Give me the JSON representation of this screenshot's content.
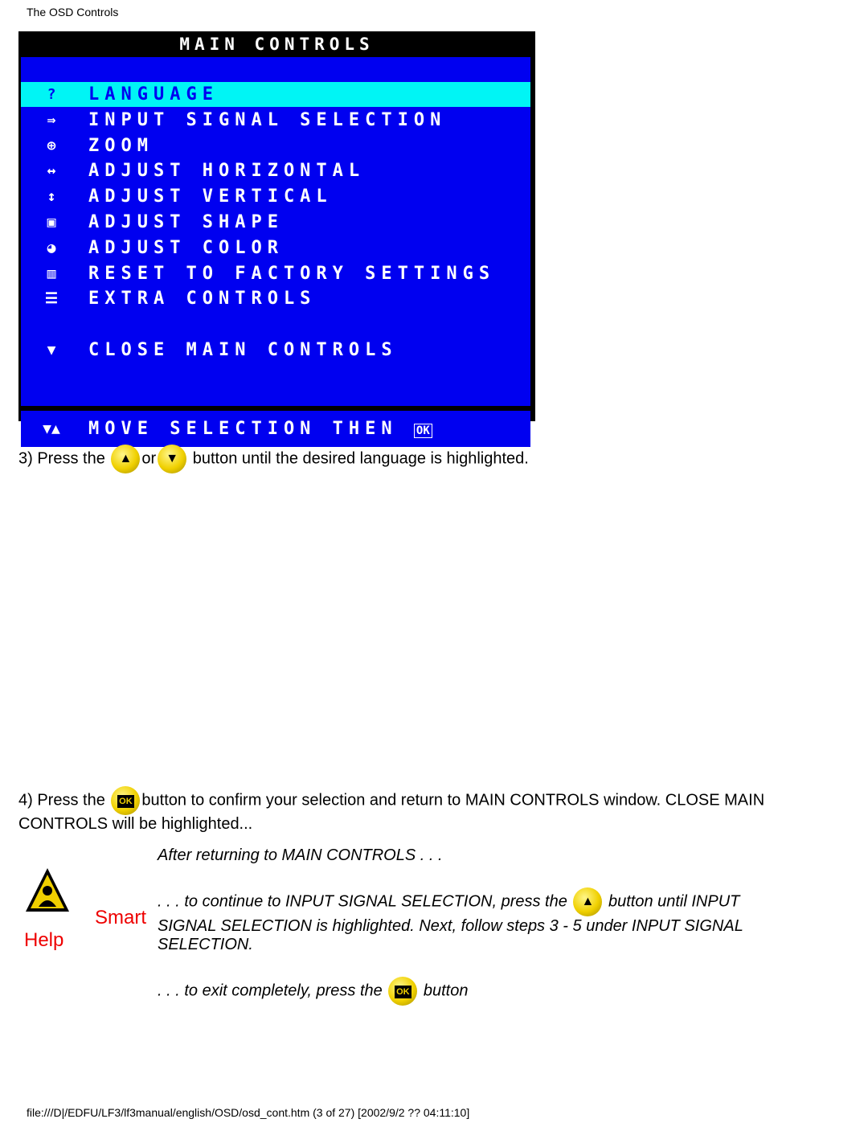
{
  "header": {
    "title": "The OSD Controls"
  },
  "osd": {
    "title": "MAIN CONTROLS",
    "items": [
      {
        "icon": "language-icon",
        "glyph": "?",
        "label": "LANGUAGE",
        "selected": true
      },
      {
        "icon": "input-signal-icon",
        "glyph": "⇛",
        "label": "INPUT SIGNAL SELECTION"
      },
      {
        "icon": "zoom-icon",
        "glyph": "⊕",
        "label": "ZOOM"
      },
      {
        "icon": "horizontal-icon",
        "glyph": "↔",
        "label": "ADJUST HORIZONTAL"
      },
      {
        "icon": "vertical-icon",
        "glyph": "↕",
        "label": "ADJUST VERTICAL"
      },
      {
        "icon": "shape-icon",
        "glyph": "▣",
        "label": "ADJUST SHAPE"
      },
      {
        "icon": "color-palette-icon",
        "glyph": "◕",
        "label": "ADJUST COLOR"
      },
      {
        "icon": "factory-reset-icon",
        "glyph": "▥",
        "label": "RESET TO FACTORY SETTINGS"
      },
      {
        "icon": "extra-controls-icon",
        "glyph": "☰",
        "label": "EXTRA CONTROLS"
      }
    ],
    "close": {
      "glyph": "▼",
      "label": "CLOSE MAIN CONTROLS"
    },
    "footer": {
      "glyph": "▼▲",
      "label": "MOVE SELECTION THEN",
      "ok": "OK"
    }
  },
  "steps": {
    "step3_pre": "3) Press the",
    "step3_or": "or",
    "step3_post": "button until the desired language is highlighted.",
    "step4_pre": "4) Press the",
    "step4_post": "button to confirm your selection and return to MAIN CONTROLS window. CLOSE MAIN",
    "step4_line2": "CONTROLS will be highlighted..."
  },
  "smart_help": {
    "smart": "Smart",
    "help": "Help",
    "intro": "After returning to MAIN CONTROLS . . .",
    "continue_pre": ". . . to continue to INPUT SIGNAL SELECTION, press the",
    "continue_post": "button until INPUT",
    "continue_line2": "SIGNAL SELECTION is highlighted. Next, follow steps 3 - 5 under INPUT SIGNAL",
    "continue_line3": "SELECTION.",
    "exit_pre": ". . . to exit completely, press the",
    "exit_post": "button"
  },
  "buttons": {
    "up": "▲",
    "down": "▼",
    "ok": "OK"
  },
  "footer": {
    "path": "file:///D|/EDFU/LF3/lf3manual/english/OSD/osd_cont.htm (3 of 27) [2002/9/2 ?? 04:11:10]"
  }
}
